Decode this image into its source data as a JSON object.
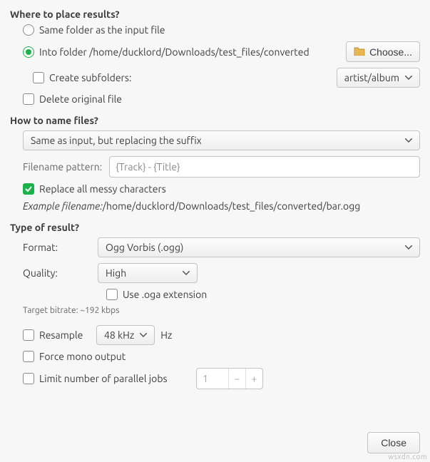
{
  "sections": {
    "place": {
      "title": "Where to place results?",
      "same_folder": "Same folder as the input file",
      "into_folder_prefix": "Into folder ",
      "into_folder_path": "/home/ducklord/Downloads/test_files/converted",
      "choose_btn": "Choose...",
      "create_subfolders": "Create subfolders:",
      "subfolder_pattern": "artist/album",
      "delete_original": "Delete original file"
    },
    "name": {
      "title": "How to name files?",
      "scheme": "Same as input, but replacing the suffix",
      "pattern_label": "Filename pattern:",
      "pattern_placeholder": "{Track} - {Title}",
      "replace_messy": "Replace all messy characters",
      "example_label": "Example filename: ",
      "example_value": "/home/ducklord/Downloads/test_files/converted/bar.ogg"
    },
    "result": {
      "title": "Type of result?",
      "format_label": "Format:",
      "format_value": "Ogg Vorbis (.ogg)",
      "quality_label": "Quality:",
      "quality_value": "High",
      "use_oga": "Use .oga extension",
      "target_bitrate": "Target bitrate: ~192 kbps",
      "resample": "Resample",
      "resample_rate": "48 kHz",
      "resample_unit": "Hz",
      "force_mono": "Force mono output",
      "limit_jobs": "Limit number of parallel jobs",
      "limit_jobs_value": "1"
    }
  },
  "footer": {
    "close": "Close"
  },
  "watermark": "wsxdn.com"
}
